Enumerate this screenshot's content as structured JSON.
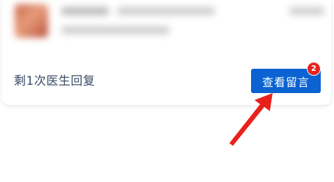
{
  "card": {
    "reply_remaining": "剩1次医生回复",
    "view_messages_label": "查看留言",
    "unread_count": "2"
  },
  "colors": {
    "button": "#0a63d1",
    "badge": "#e52421",
    "arrow": "#e8221b",
    "reply_text": "#3a4a66"
  },
  "icons": {
    "pointer": "red-arrow-icon"
  }
}
